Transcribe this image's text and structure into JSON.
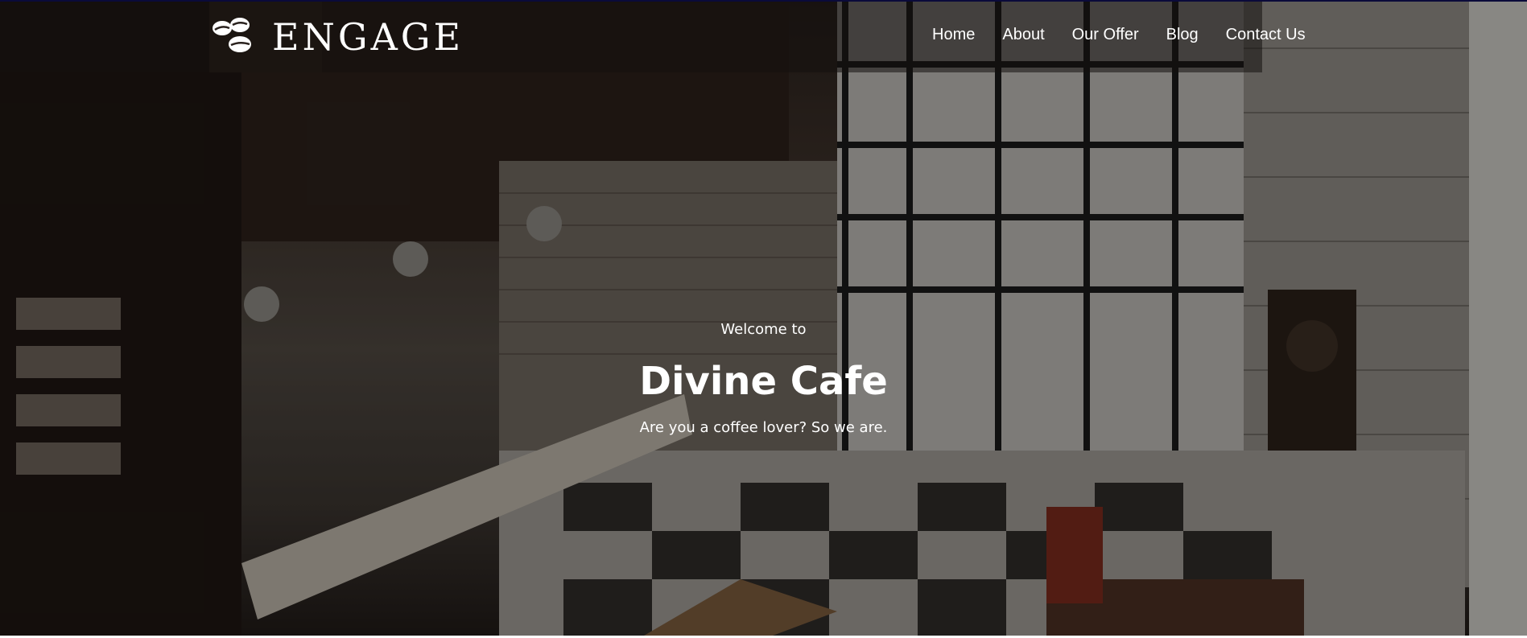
{
  "brand": {
    "name": "ENGAGE",
    "logo_icon": "coffee-beans-icon"
  },
  "nav": {
    "items": [
      {
        "label": "Home"
      },
      {
        "label": "About"
      },
      {
        "label": "Our Offer"
      },
      {
        "label": "Blog"
      },
      {
        "label": "Contact Us"
      }
    ]
  },
  "hero": {
    "welcome": "Welcome to",
    "title": "Divine Cafe",
    "subtitle": "Are you a coffee lover? So we are."
  },
  "colors": {
    "nav_text": "#ffffff",
    "header_overlay": "#14100e",
    "top_accent": "#0a0a3a"
  }
}
